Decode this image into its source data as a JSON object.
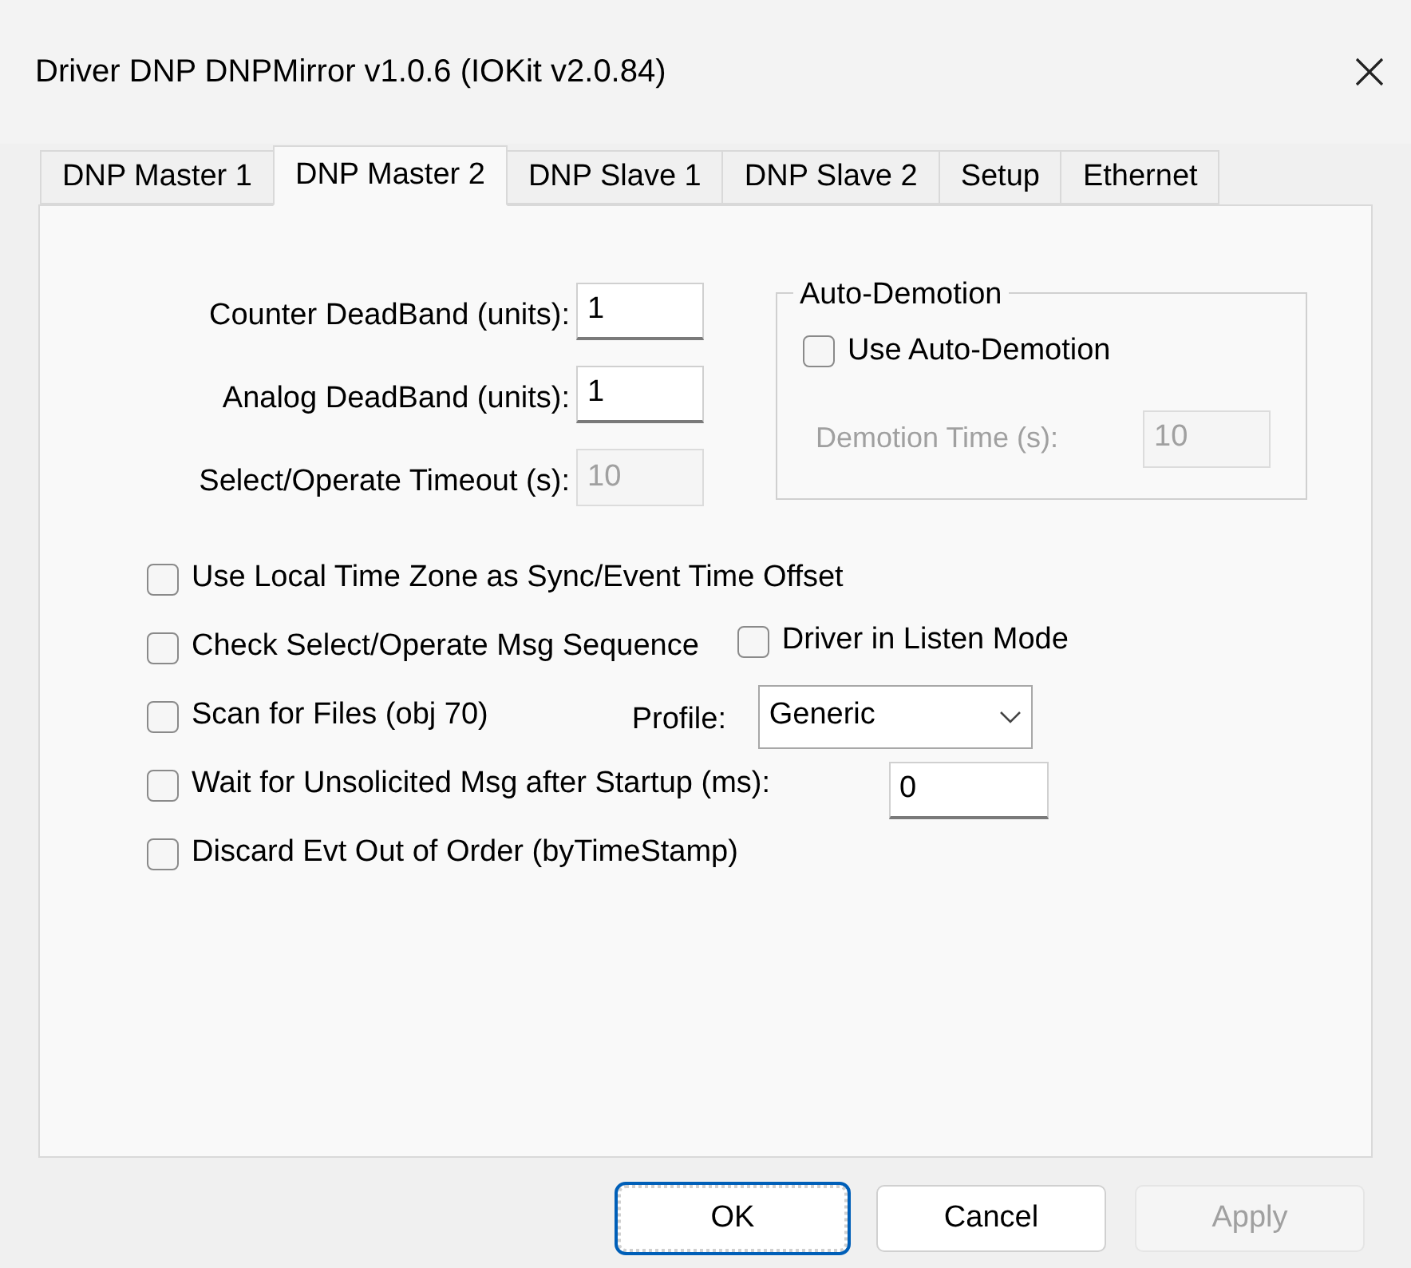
{
  "window": {
    "title": "Driver DNP DNPMirror v1.0.6 (IOKit v2.0.84)"
  },
  "tabs": [
    {
      "label": "DNP Master 1",
      "selected": false
    },
    {
      "label": "DNP Master 2",
      "selected": true
    },
    {
      "label": "DNP Slave 1",
      "selected": false
    },
    {
      "label": "DNP Slave 2",
      "selected": false
    },
    {
      "label": "Setup",
      "selected": false
    },
    {
      "label": "Ethernet",
      "selected": false
    }
  ],
  "fields": [
    {
      "label": "Counter DeadBand (units):",
      "value": "1",
      "disabled": false
    },
    {
      "label": "Analog DeadBand (units):",
      "value": "1",
      "disabled": false
    },
    {
      "label": "Select/Operate Timeout (s):",
      "value": "10",
      "disabled": true
    }
  ],
  "auto_demotion": {
    "title": "Auto-Demotion",
    "checkbox": {
      "label": "Use Auto-Demotion",
      "checked": false
    },
    "field": {
      "label": "Demotion Time (s):",
      "value": "10",
      "disabled": true
    }
  },
  "options": [
    {
      "kind": "plain",
      "label": "Use Local Time Zone as Sync/Event Time Offset",
      "checked": false
    },
    {
      "kind": "checkbox",
      "label": "Check Select/Operate Msg Sequence",
      "checked": false,
      "extra": {
        "label": "Driver in Listen Mode",
        "checked": false
      }
    },
    {
      "kind": "select",
      "label": "Scan for Files (obj 70)",
      "checked": false,
      "extra": {
        "label": "Profile:",
        "value": "Generic"
      }
    },
    {
      "kind": "input",
      "label": "Wait for Unsolicited Msg after Startup (ms):",
      "checked": false,
      "extra": {
        "value": "0"
      }
    },
    {
      "kind": "plain",
      "label": "Discard Evt Out of Order (byTimeStamp)",
      "checked": false
    }
  ],
  "buttons": [
    {
      "label": "OK",
      "default": true,
      "disabled": false
    },
    {
      "label": "Cancel",
      "default": false,
      "disabled": false
    },
    {
      "label": "Apply",
      "default": false,
      "disabled": true
    }
  ]
}
